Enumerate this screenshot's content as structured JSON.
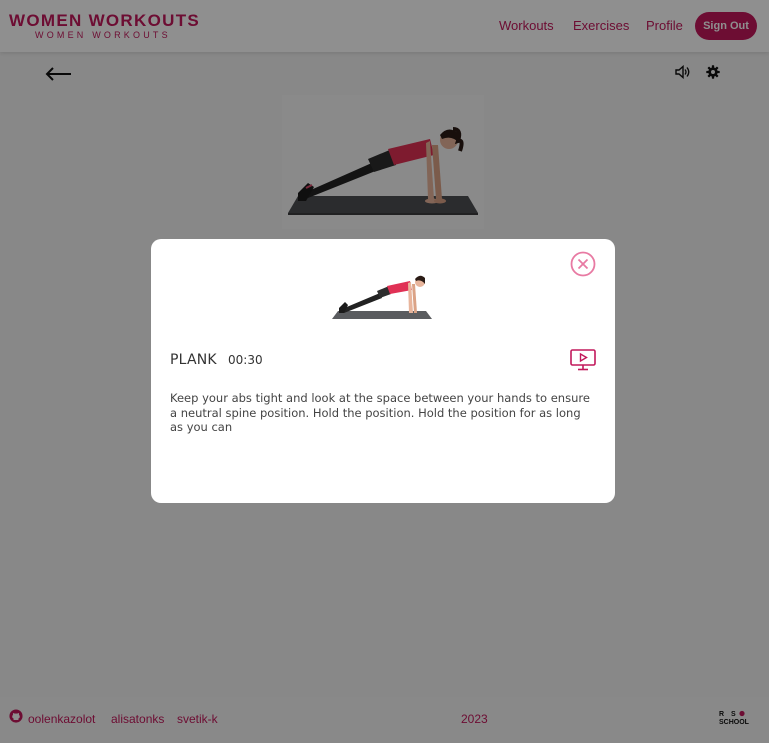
{
  "header": {
    "logo_main": "WOMEN WORKOUTS",
    "logo_sub": "WOMEN WORKOUTS",
    "nav": [
      "Workouts",
      "Exercises",
      "Profile"
    ],
    "signout_label": "Sign Out"
  },
  "toolbar": {
    "back_icon": "arrow-left-icon",
    "sound_icon": "speaker-icon",
    "settings_icon": "gear-icon"
  },
  "exercise": {
    "image_alt": "plank-exercise-image"
  },
  "modal": {
    "name": "PLANK",
    "time": "00:30",
    "description": "Keep your abs tight and look at the space between your hands to ensure a neutral spine position. Hold the position. Hold the position for as long as you can",
    "close_icon": "close-circle-icon",
    "video_icon": "video-play-icon"
  },
  "footer": {
    "authors": [
      "oolenkazolot",
      "alisatonks",
      "svetik-k"
    ],
    "year": "2023",
    "github_icon": "github-icon",
    "school_logo": "rs-school-logo"
  },
  "colors": {
    "accent": "#c2185b",
    "close_accent": "#e87aa3",
    "overlay": "rgba(0,0,0,0.44)"
  }
}
